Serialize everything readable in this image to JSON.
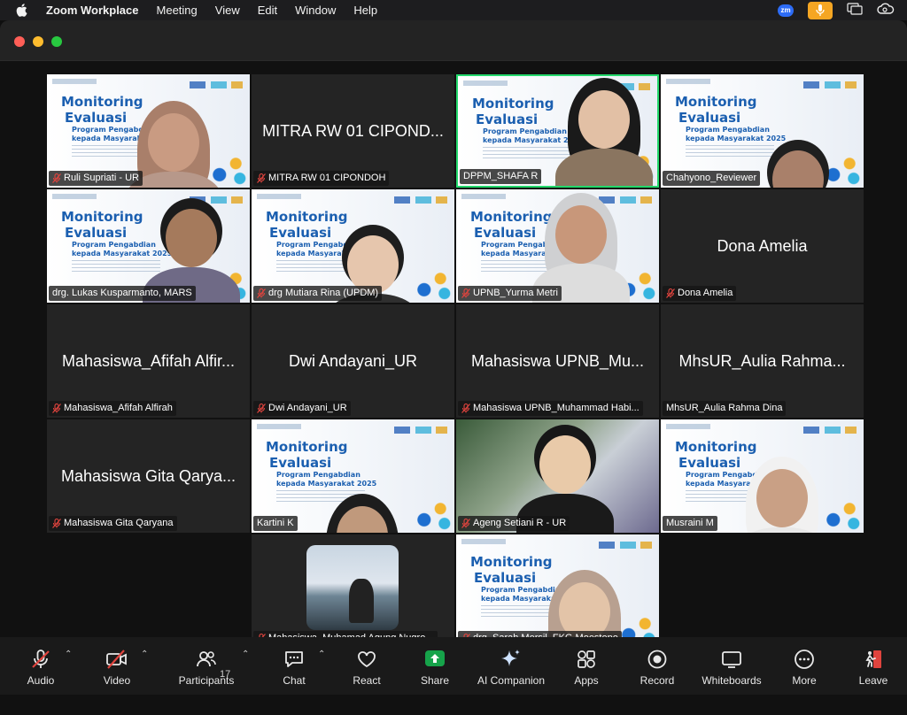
{
  "menubar": {
    "app_name": "Zoom Workplace",
    "items": [
      "Meeting",
      "View",
      "Edit",
      "Window",
      "Help"
    ],
    "zm_badge": "zm"
  },
  "window": {
    "traffic_lights": [
      "close",
      "minimize",
      "zoom"
    ]
  },
  "slide": {
    "title_line1": "Monitoring",
    "title_line2": "Evaluasi",
    "subtitle_line1": "Program Pengabdian",
    "subtitle_line2": "kepada Masyarakat 2025"
  },
  "participants": [
    {
      "label": "Ruli Supriati - UR",
      "muted": true,
      "video": true
    },
    {
      "label": "MITRA RW 01 CIPONDOH",
      "bigname": "MITRA RW 01 CIPOND...",
      "muted": true,
      "video": false
    },
    {
      "label": "DPPM_SHAFA R",
      "muted": false,
      "video": true,
      "active": true
    },
    {
      "label": "Chahyono_Reviewer",
      "muted": false,
      "video": true
    },
    {
      "label": "drg. Lukas Kusparmanto, MARS",
      "muted": false,
      "video": true
    },
    {
      "label": "drg Mutiara Rina (UPDM)",
      "muted": true,
      "video": true
    },
    {
      "label": "UPNB_Yurma Metri",
      "muted": true,
      "video": true
    },
    {
      "label": "Dona Amelia",
      "bigname": "Dona Amelia",
      "muted": true,
      "video": false
    },
    {
      "label": "Mahasiswa_Afifah Alfirah",
      "bigname": "Mahasiswa_Afifah Alfir...",
      "muted": true,
      "video": false
    },
    {
      "label": "Dwi Andayani_UR",
      "bigname": "Dwi Andayani_UR",
      "muted": true,
      "video": false
    },
    {
      "label": "Mahasiswa UPNB_Muhammad Habi...",
      "bigname": "Mahasiswa UPNB_Mu...",
      "muted": true,
      "video": false
    },
    {
      "label": "MhsUR_Aulia Rahma Dina",
      "bigname": "MhsUR_Aulia Rahma...",
      "muted": false,
      "video": false
    },
    {
      "label": "Mahasiswa Gita Qaryana",
      "bigname": "Mahasiswa Gita Qarya...",
      "muted": true,
      "video": false
    },
    {
      "label": "Kartini K",
      "muted": false,
      "video": true
    },
    {
      "label": "Ageng Setiani R - UR",
      "muted": true,
      "video": true
    },
    {
      "label": "Musraini M",
      "muted": false,
      "video": true
    },
    {
      "label": "Mahasiswa_Muhamad Agung Nugro...",
      "muted": true,
      "video": true
    },
    {
      "label": "drg. Sarah Mersil_FKG Moestopo",
      "muted": true,
      "video": true
    }
  ],
  "toolbar": {
    "audio": "Audio",
    "video": "Video",
    "participants": "Participants",
    "participants_count": "17",
    "chat": "Chat",
    "react": "React",
    "share": "Share",
    "ai_companion": "AI Companion",
    "apps": "Apps",
    "record": "Record",
    "whiteboards": "Whiteboards",
    "more": "More",
    "leave": "Leave"
  },
  "colors": {
    "active_speaker": "#23d96c",
    "share_green": "#16a34a",
    "muted_red": "#e0443e",
    "leave_red": "#e0443e"
  }
}
